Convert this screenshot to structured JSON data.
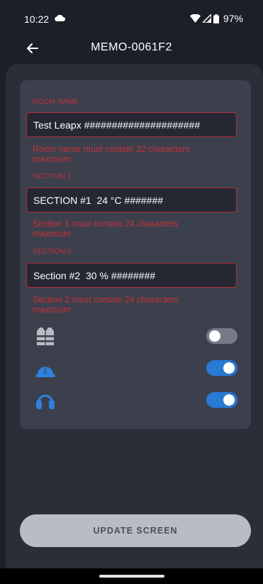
{
  "status_bar": {
    "time": "10:22",
    "battery": "97%"
  },
  "app_bar": {
    "title": "MEMO-0061F2"
  },
  "form": {
    "room_name": {
      "label": "ROOM NAME",
      "value": "Test Leapx #####################",
      "error": "Room name must contain 32 characters maximum"
    },
    "section_1": {
      "label": "SECTION 1",
      "value": "SECTION #1  24 °C #######",
      "error": "Section 1 must contain 24 characters maximum"
    },
    "section_2": {
      "label": "SECTION 2",
      "value": "Section #2  30 % ########",
      "error": "Section 2 must contain 24 characters maximum"
    },
    "toggles": [
      {
        "icon": "safety-vest-icon",
        "state": "off"
      },
      {
        "icon": "hard-hat-icon",
        "state": "on"
      },
      {
        "icon": "ear-protection-icon",
        "state": "on"
      }
    ]
  },
  "footer": {
    "update_label": "UPDATE SCREEN"
  },
  "colors": {
    "error": "#c6303a",
    "toggle_on": "#2979d6",
    "icon_blue": "#2f80e0",
    "icon_gray": "#b8bcc4"
  }
}
